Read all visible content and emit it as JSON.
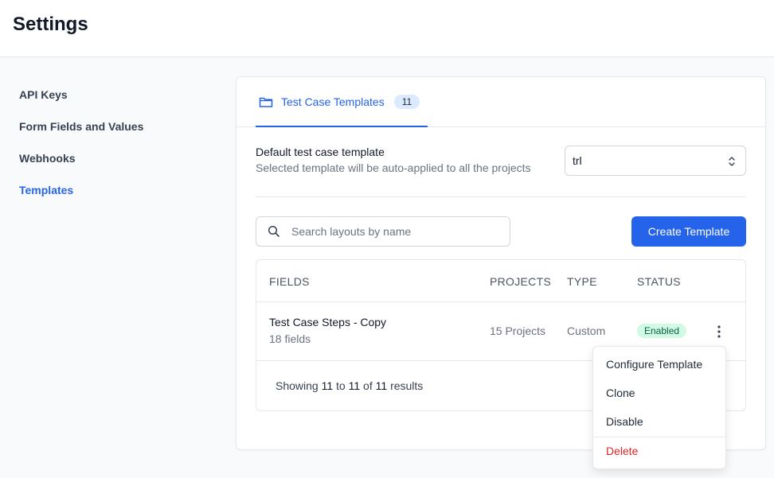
{
  "header": {
    "title": "Settings"
  },
  "sidebar": {
    "items": [
      {
        "label": "API Keys",
        "active": false
      },
      {
        "label": "Form Fields and Values",
        "active": false
      },
      {
        "label": "Webhooks",
        "active": false
      },
      {
        "label": "Templates",
        "active": true
      }
    ]
  },
  "tabs": [
    {
      "label": "Test Case Templates",
      "count": "11",
      "icon": "folder-icon",
      "active": true
    }
  ],
  "default_template": {
    "title": "Default test case template",
    "description": "Selected template will be auto-applied to all the projects",
    "selected": "trl"
  },
  "search": {
    "placeholder": "Search layouts by name",
    "value": ""
  },
  "actions": {
    "create_label": "Create Template"
  },
  "table": {
    "columns": [
      "FIELDS",
      "PROJECTS",
      "TYPE",
      "STATUS"
    ],
    "rows": [
      {
        "name": "Test Case Steps - Copy",
        "fields": "18 fields",
        "projects": "15 Projects",
        "type": "Custom",
        "status": "Enabled"
      }
    ]
  },
  "pagination": {
    "prefix": "Showing",
    "from": "11",
    "to_word": "to",
    "to": "11",
    "of_word": "of",
    "total": "11",
    "suffix": "results"
  },
  "context_menu": {
    "items": [
      "Configure Template",
      "Clone",
      "Disable"
    ],
    "danger_item": "Delete"
  },
  "colors": {
    "accent": "#2563eb",
    "enabled_bg": "#d1fae5",
    "enabled_text": "#065f46",
    "danger": "#dc2626"
  }
}
